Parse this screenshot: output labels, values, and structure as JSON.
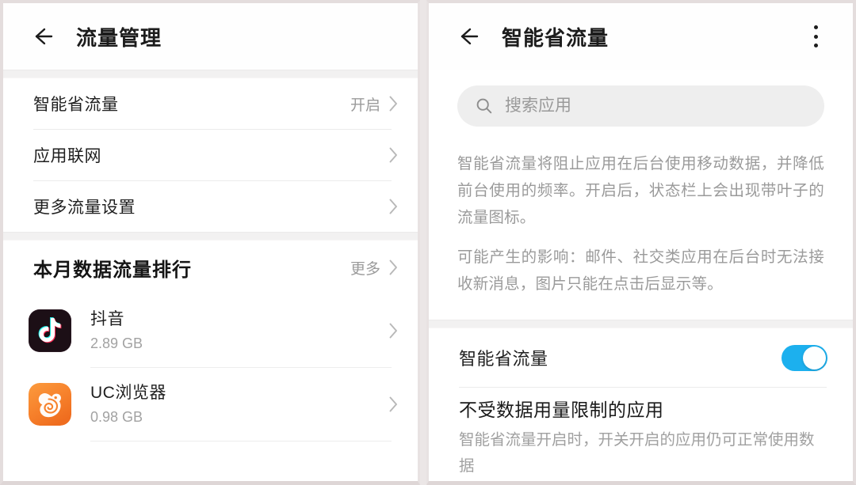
{
  "theme": {
    "page_bg": "#e9e4e4",
    "card_bg": "#ffffff",
    "band_bg": "#f2f1f1",
    "accent_toggle_on": "#1cb0ee",
    "text_primary": "#1f1f1f",
    "text_secondary": "#9b9b9b",
    "divider": "#ebebeb",
    "search_bg": "#eeeeee"
  },
  "left_screen": {
    "appbar": {
      "back_icon": "arrow-left-icon",
      "title": "流量管理"
    },
    "settings_group": [
      {
        "label": "智能省流量",
        "value": "开启",
        "chevron": "chevron-right-icon"
      },
      {
        "label": "应用联网",
        "value": "",
        "chevron": "chevron-right-icon"
      },
      {
        "label": "更多流量设置",
        "value": "",
        "chevron": "chevron-right-icon"
      }
    ],
    "ranking_section": {
      "title": "本月数据流量排行",
      "more_label": "更多",
      "more_chevron": "chevron-right-icon",
      "apps": [
        {
          "name": "抖音",
          "usage": "2.89 GB",
          "icon": "douyin-app-icon",
          "icon_bg": "#1a0d14",
          "icon_accent": "#25f4ee",
          "icon_accent2": "#fe2c55",
          "chevron": "chevron-right-icon"
        },
        {
          "name": "UC浏览器",
          "usage": "0.98 GB",
          "icon": "uc-browser-app-icon",
          "icon_bg": "#f7822c",
          "icon_accent": "#ffffff",
          "icon_accent2": "#ffd9b0",
          "chevron": "chevron-right-icon"
        }
      ]
    }
  },
  "right_screen": {
    "appbar": {
      "back_icon": "arrow-left-icon",
      "title": "智能省流量",
      "overflow_icon": "kebab-menu-icon"
    },
    "search": {
      "icon": "search-icon",
      "placeholder": "搜索应用",
      "value": ""
    },
    "description": {
      "paragraph_1": "智能省流量将阻止应用在后台使用移动数据，并降低前台使用的频率。开启后，状态栏上会出现带叶子的流量图标。",
      "paragraph_2": "可能产生的影响：邮件、社交类应用在后台时无法接收新消息，图片只能在点击后显示等。"
    },
    "main_toggle": {
      "label": "智能省流量",
      "state": "on"
    },
    "exempt_entry": {
      "title": "不受数据用量限制的应用",
      "subtitle": "智能省流量开启时，开关开启的应用仍可正常使用数据"
    }
  }
}
